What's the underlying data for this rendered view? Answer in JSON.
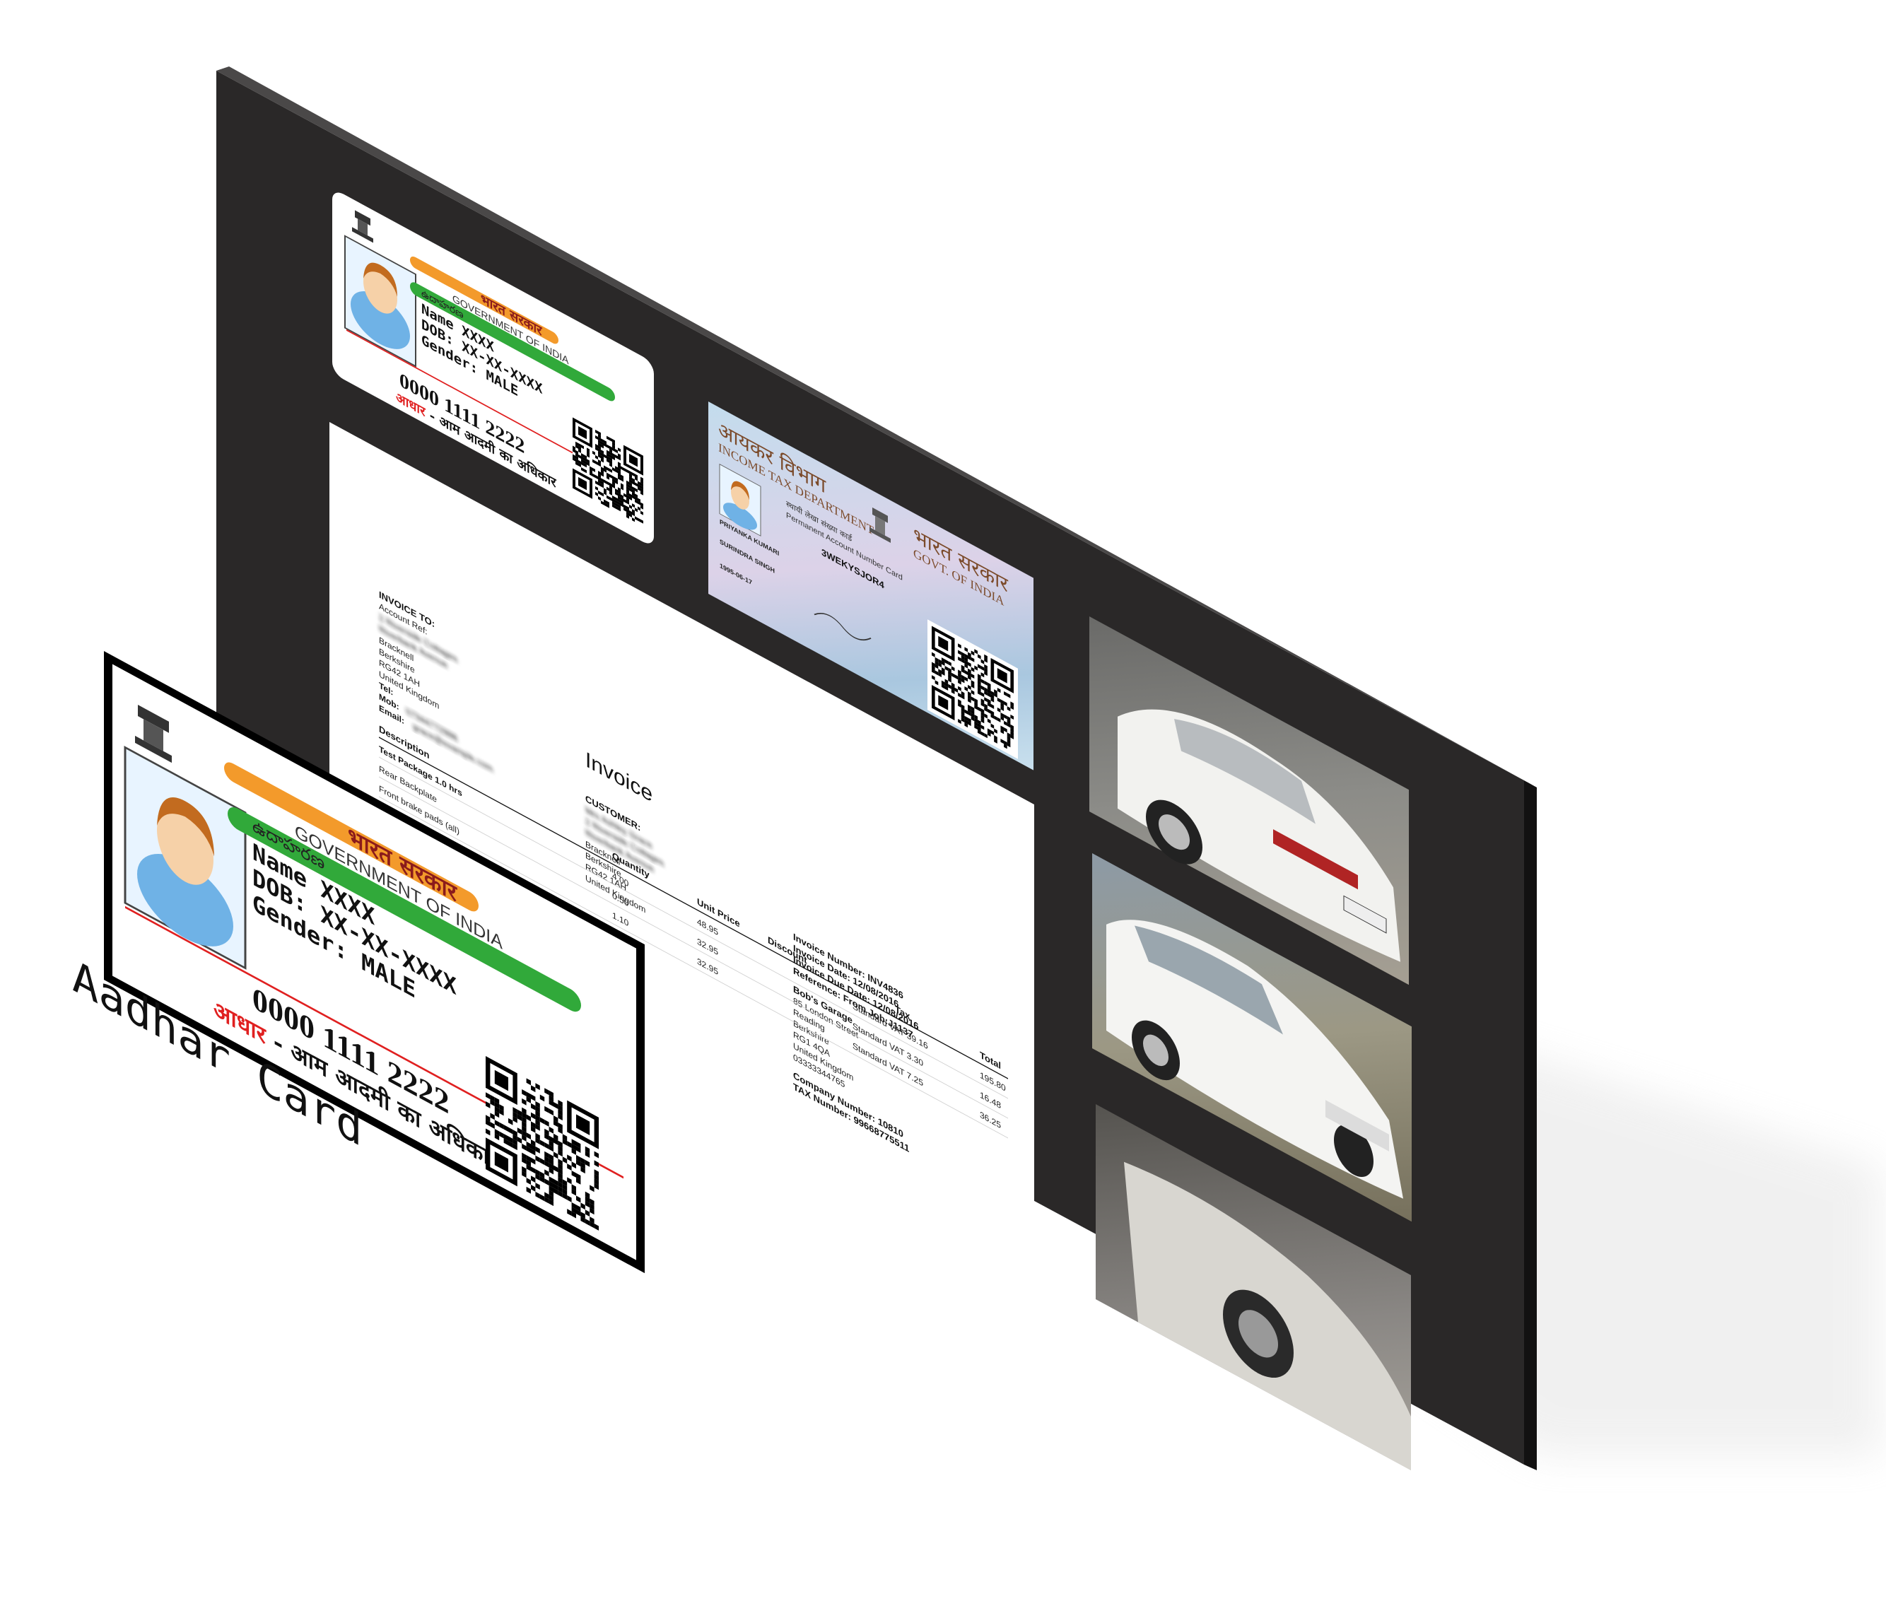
{
  "aadhaar_card": {
    "header_hindi": "भारत सरकार",
    "header_english": "GOVERNMENT OF INDIA",
    "regional_text": "ఉదాహరణ",
    "name_line": "Name XXXX",
    "dob_line": "DOB: XX-XX-XXXX",
    "gender_line": "Gender: MALE",
    "number": "0000 1111 2222",
    "footer_red": "आधार",
    "footer_black": " - आम आदमी का अधिकार"
  },
  "pan_card": {
    "title_hindi": "आयकर विभाग",
    "title_english": "INCOME TAX DEPARTMENT",
    "govt_hindi": "भारत सरकार",
    "govt_english": "GOVT. OF INDIA",
    "subtitle_hindi": "स्थायी लेखा संख्या कार्ड",
    "subtitle_english": "Permanent Account Number Card",
    "pan_number": "3WEKYSJOR4",
    "holder_name": "PRIYANKA KUMARI",
    "father_name": "SURINDRA SINGH",
    "dob": "1995-06-17"
  },
  "invoice": {
    "title": "Invoice",
    "invoice_to": {
      "heading": "INVOICE TO:",
      "lines": [
        "Account Ref:",
        "2 Riverside Cottages",
        "Riverbank Avenue",
        "Bracknell",
        "Berkshire",
        "RG42 1AH",
        "United Kingdom"
      ],
      "tel_label": "Tel:",
      "mob_label": "Mob:",
      "mob_value": "07344772996",
      "email_label": "Email:",
      "email_value": "grace@example.com"
    },
    "customer": {
      "heading": "CUSTOMER:",
      "lines": [
        "Mrs Ashley Grace",
        "2 Riverside Cottages",
        "Riverbank Avenue",
        "Bracknell",
        "Berkshire",
        "RG42 1AH",
        "United Kingdom"
      ]
    },
    "meta": {
      "invoice_number": "Invoice Number: INV4836",
      "invoice_date": "Invoice Date: 12/08/2016",
      "due_date": "Invoice Due Date: 12/08/2016",
      "reference": "Reference: From Job:J1137"
    },
    "garage": {
      "name": "Bob's Garage",
      "lines": [
        "85 London Street",
        "Reading",
        "Berkshire",
        "RG1 4QA",
        "United Kingdom",
        "03333344765"
      ]
    },
    "company_number": "Company Number: 10810",
    "tax_number": "TAX Number: 99668775511",
    "headers": [
      "Description",
      "Quantity",
      "Unit Price",
      "Discount",
      "Tax",
      "Total"
    ],
    "rows": [
      {
        "description": "Test Package 1.0 hrs",
        "quantity": "4.00",
        "unit_price": "48.95",
        "tax": "Standard VAT 39.16",
        "total": "195.80"
      },
      {
        "description": "Rear Backplate",
        "quantity": "0.50",
        "unit_price": "32.95",
        "tax": "Standard VAT 3.30",
        "total": "16.48"
      },
      {
        "description": "Front brake pads (all)",
        "quantity": "1.10",
        "unit_price": "32.95",
        "tax": "Standard VAT 7.25",
        "total": "36.25"
      }
    ]
  },
  "label": {
    "text": "Aadhar Card"
  },
  "colors": {
    "board": "#2a2828",
    "board_side": "#141313",
    "saffron": "#f39a2b",
    "green": "#31a93a",
    "red_line": "#e02020",
    "pan_blue": "#aecde3"
  }
}
